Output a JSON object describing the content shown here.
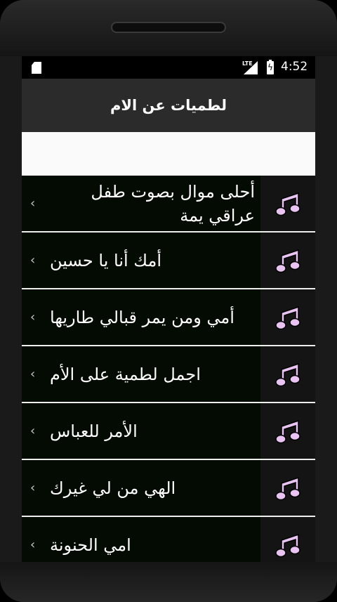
{
  "status_bar": {
    "time": "4:52",
    "network": "LTE"
  },
  "app_bar": {
    "title": "لطميات عن الام"
  },
  "list": {
    "items": [
      {
        "label": "أحلى موال بصوت طفل عراقي يمة",
        "icon": "music-note-icon"
      },
      {
        "label": "أمك أنا يا حسين",
        "icon": "music-note-icon"
      },
      {
        "label": "أمي ومن يمر قبالي طاريها",
        "icon": "music-note-icon"
      },
      {
        "label": "اجمل لطمية على الأم",
        "icon": "music-note-icon"
      },
      {
        "label": "الأمر للعباس",
        "icon": "music-note-icon"
      },
      {
        "label": "الهي من لي غيرك",
        "icon": "music-note-icon"
      },
      {
        "label": "امي الحنونة",
        "icon": "music-note-icon"
      }
    ],
    "chevron": "‹"
  },
  "colors": {
    "app_bar": "#2b2b2b",
    "row_background": "#030b03",
    "icon_cell": "#141414",
    "note_fill": "#e9c4f2",
    "divider": "#eeeeee"
  }
}
